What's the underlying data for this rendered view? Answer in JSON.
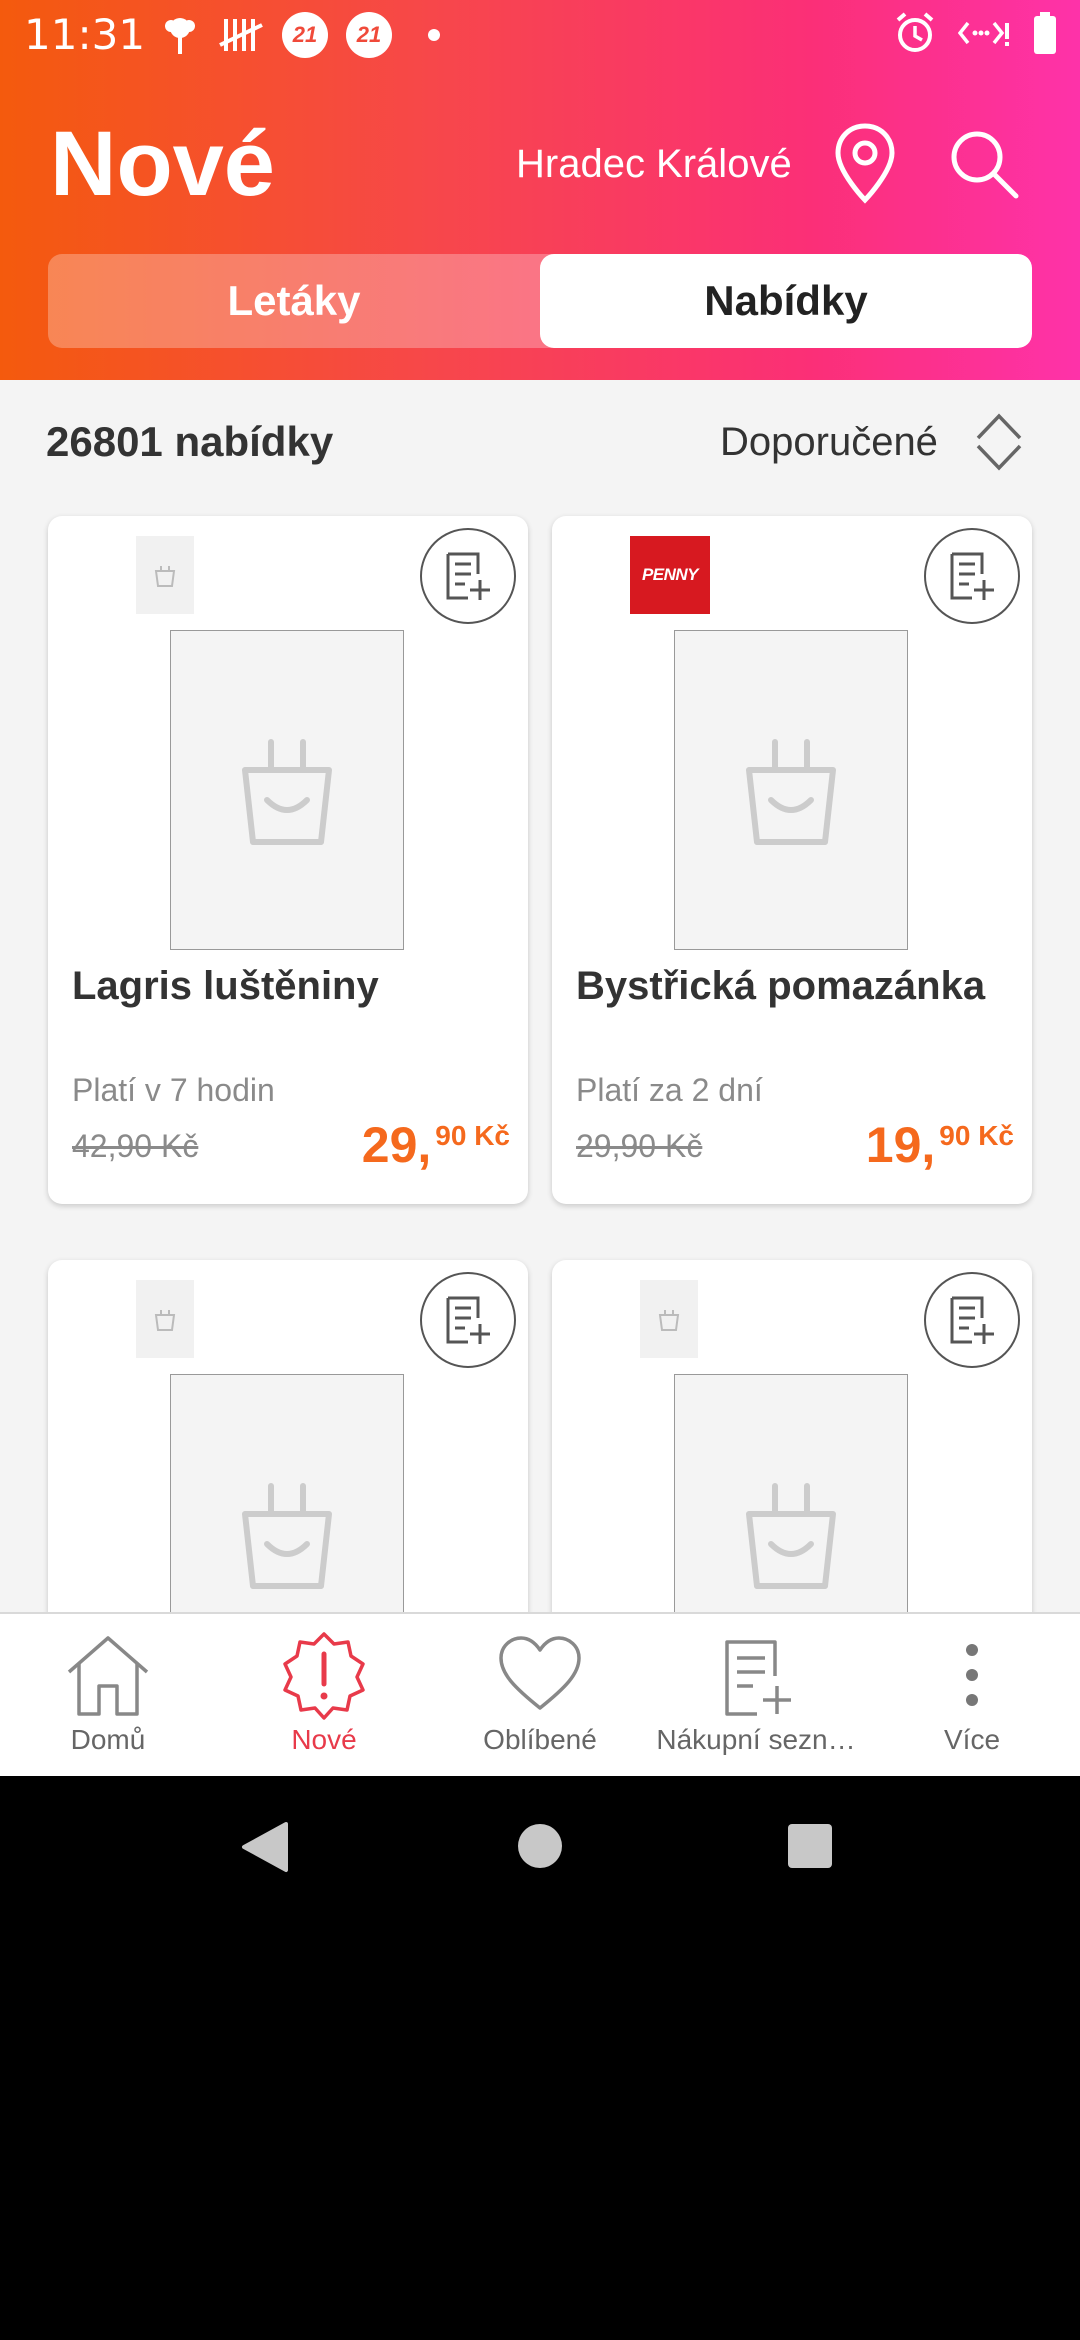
{
  "status_bar": {
    "time": "11:31",
    "badge1": "21",
    "badge2": "21",
    "icons": [
      "flower-icon",
      "tally-icon",
      "alarm-icon",
      "data-icon",
      "battery-icon"
    ]
  },
  "header": {
    "title": "Nové",
    "location": "Hradec Králové",
    "tabs": [
      {
        "label": "Letáky",
        "active": false
      },
      {
        "label": "Nabídky",
        "active": true
      }
    ]
  },
  "list": {
    "count": "26801 nabídky",
    "sort": "Doporučené"
  },
  "products": [
    {
      "name": "Lagris luštěniny",
      "valid": "Platí v 7 hodin",
      "old_price": "42,90 Kč",
      "price_main": "29,",
      "price_sub": "90 Kč",
      "logo": "placeholder"
    },
    {
      "name": "Bystřická pomazánka",
      "valid": "Platí za 2 dní",
      "old_price": "29,90 Kč",
      "price_main": "19,",
      "price_sub": "90 Kč",
      "logo": "PENNY"
    },
    {
      "name": "",
      "valid": "",
      "old_price": "",
      "price_main": "",
      "price_sub": "",
      "logo": "placeholder"
    },
    {
      "name": "",
      "valid": "",
      "old_price": "",
      "price_main": "",
      "price_sub": "",
      "logo": "placeholder"
    }
  ],
  "bottom_nav": [
    {
      "label": "Domů",
      "icon": "home-icon",
      "active": false
    },
    {
      "label": "Nové",
      "icon": "alert-badge-icon",
      "active": true
    },
    {
      "label": "Oblíbené",
      "icon": "heart-icon",
      "active": false
    },
    {
      "label": "Nákupní sezn…",
      "icon": "shopping-list-icon",
      "active": false
    },
    {
      "label": "Více",
      "icon": "more-icon",
      "active": false
    }
  ],
  "colors": {
    "accent": "#e83a4a",
    "price": "#f5691d",
    "gradient_start": "#f45a0d",
    "gradient_end": "#fe32a9"
  }
}
